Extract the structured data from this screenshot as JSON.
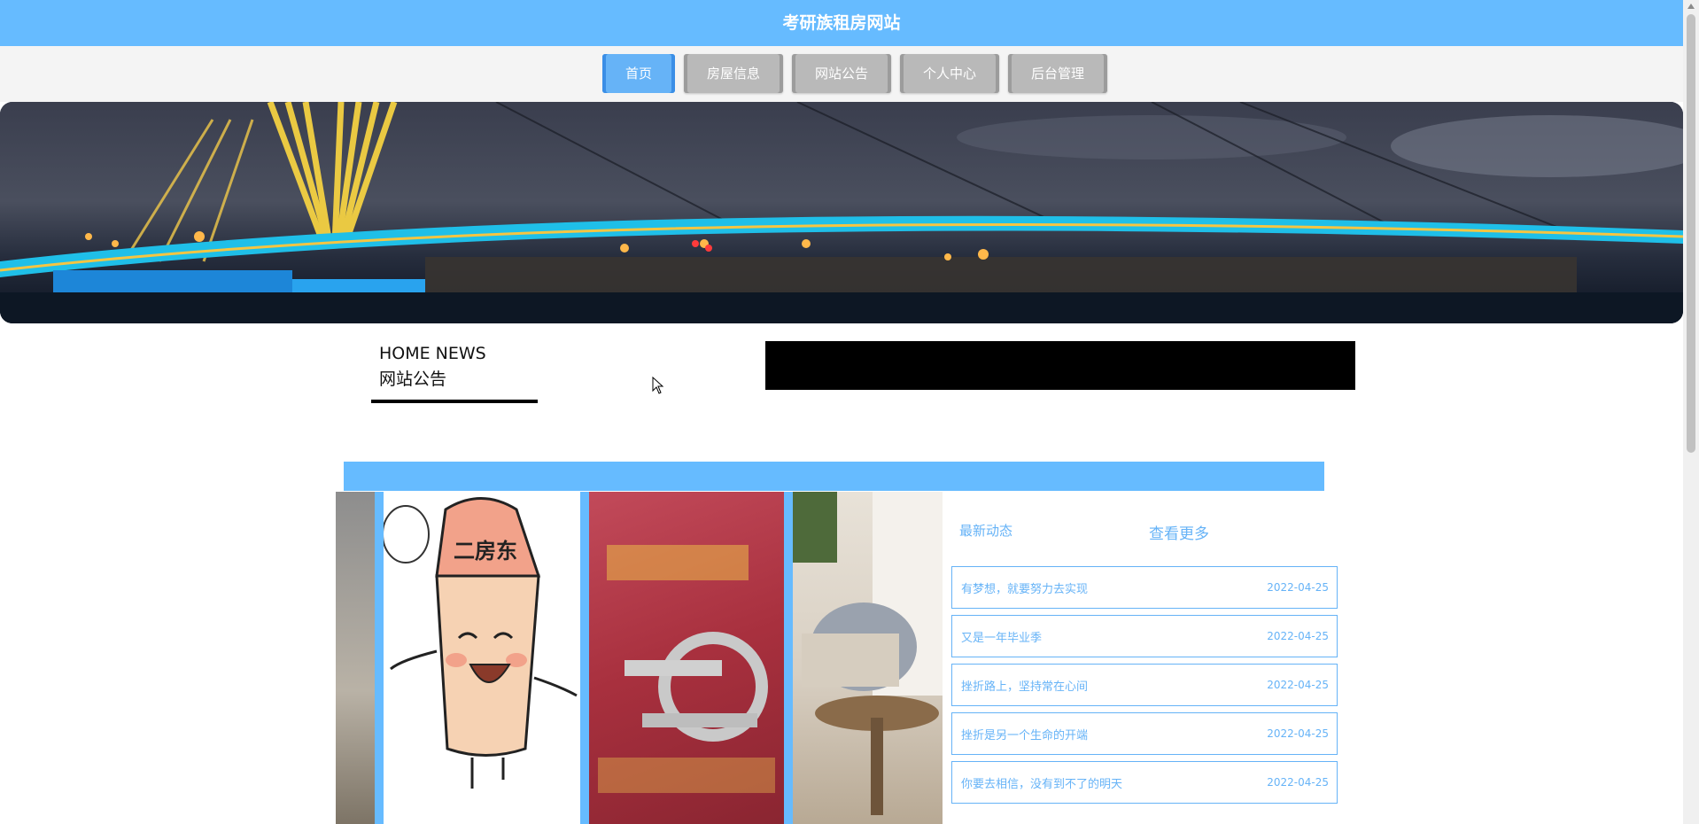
{
  "header": {
    "title": "考研族租房网站"
  },
  "nav": {
    "items": [
      {
        "label": "首页"
      },
      {
        "label": "房屋信息"
      },
      {
        "label": "网站公告"
      },
      {
        "label": "个人中心"
      },
      {
        "label": "后台管理"
      }
    ],
    "active_color": "#66b3f7",
    "inactive_color": "#b9b9b9"
  },
  "notice_section": {
    "heading_en": "HOME NEWS",
    "heading_cn": "网站公告"
  },
  "news_card": {
    "title": "最新动态",
    "more_label": "查看更多",
    "items": [
      {
        "text": "有梦想，就要努力去实现",
        "date": "2022-04-25"
      },
      {
        "text": "又是一年毕业季",
        "date": "2022-04-25"
      },
      {
        "text": "挫折路上，坚持常在心间",
        "date": "2022-04-25"
      },
      {
        "text": "挫折是另一个生命的开端",
        "date": "2022-04-25"
      },
      {
        "text": "你要去相信，没有到不了的明天",
        "date": "2022-04-25"
      }
    ]
  },
  "photo_captions": {
    "landlord_sign": "二房东"
  },
  "colors": {
    "accent": "#66bbff",
    "page_bg": "#ffffff"
  }
}
